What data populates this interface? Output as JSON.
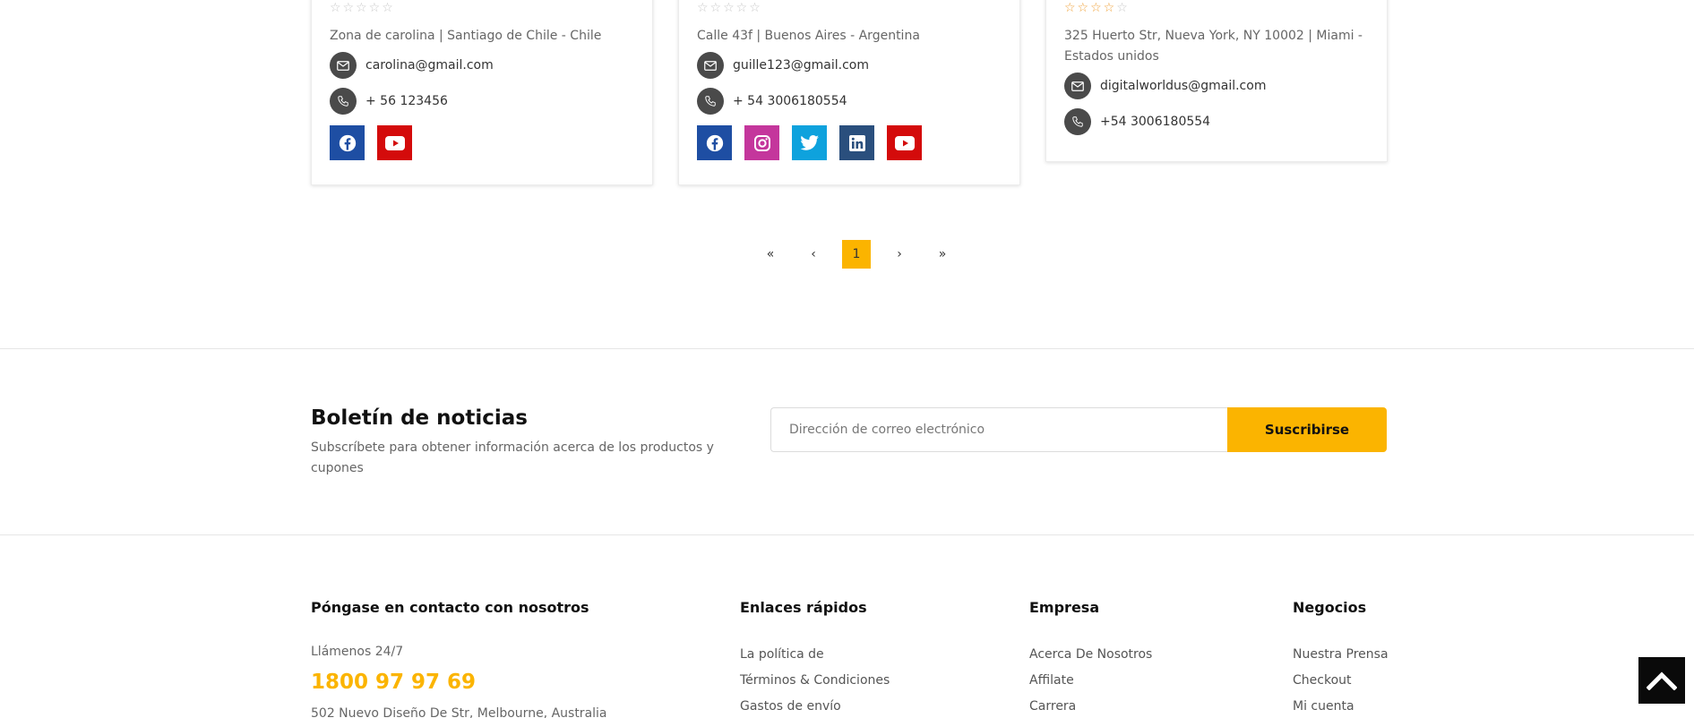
{
  "stores": [
    {
      "rating": "☆☆☆☆☆",
      "address": "Zona de carolina | Santiago de Chile - Chile",
      "email": "carolina@gmail.com",
      "phone": "+ 56 123456",
      "socials": [
        "facebook-icon",
        "youtube-icon"
      ]
    },
    {
      "rating": "☆☆☆☆☆",
      "address": "Calle 43f | Buenos Aires - Argentina",
      "email": "guille123@gmail.com",
      "phone": "+ 54 3006180554",
      "socials": [
        "facebook-icon",
        "instagram-icon",
        "twitter-icon",
        "linkedin-icon",
        "youtube-icon"
      ]
    },
    {
      "rating_filled": "☆☆☆☆",
      "rating_empty": "☆",
      "address": "325 Huerto Str, Nueva York, NY 10002 | Miami - Estados unidos",
      "email": "digitalworldus@gmail.com",
      "phone": "+54 3006180554"
    }
  ],
  "pagination": {
    "first": "«",
    "prev": "‹",
    "current": "1",
    "next": "›",
    "last": "»"
  },
  "newsletter": {
    "title": "Boletín de noticias",
    "subtitle": "Subscríbete para obtener información acerca de los productos y cupones",
    "placeholder": "Dirección de correo electrónico",
    "button": "Suscribirse"
  },
  "footer": {
    "contact": {
      "heading": "Póngase en contacto con nosotros",
      "call_label": "Llámenos 24/7",
      "phone": "1800 97 97 69",
      "address": "502 Nuevo Diseño De Str, Melbourne, Australia"
    },
    "quick_links": {
      "heading": "Enlaces rápidos",
      "items": [
        "La política de",
        "Términos & Condiciones",
        "Gastos de envío"
      ]
    },
    "company": {
      "heading": "Empresa",
      "items": [
        "Acerca De Nosotros",
        "Affilate",
        "Carrera"
      ]
    },
    "business": {
      "heading": "Negocios",
      "items": [
        "Nuestra Prensa",
        "Checkout",
        "Mi cuenta"
      ]
    }
  },
  "colors": {
    "accent": "#fbb400",
    "facebook": "#1e4ea3",
    "youtube": "#d40b0b",
    "instagram": "#c4369c",
    "twitter": "#0ea2dd",
    "linkedin": "#2a4f7d"
  }
}
